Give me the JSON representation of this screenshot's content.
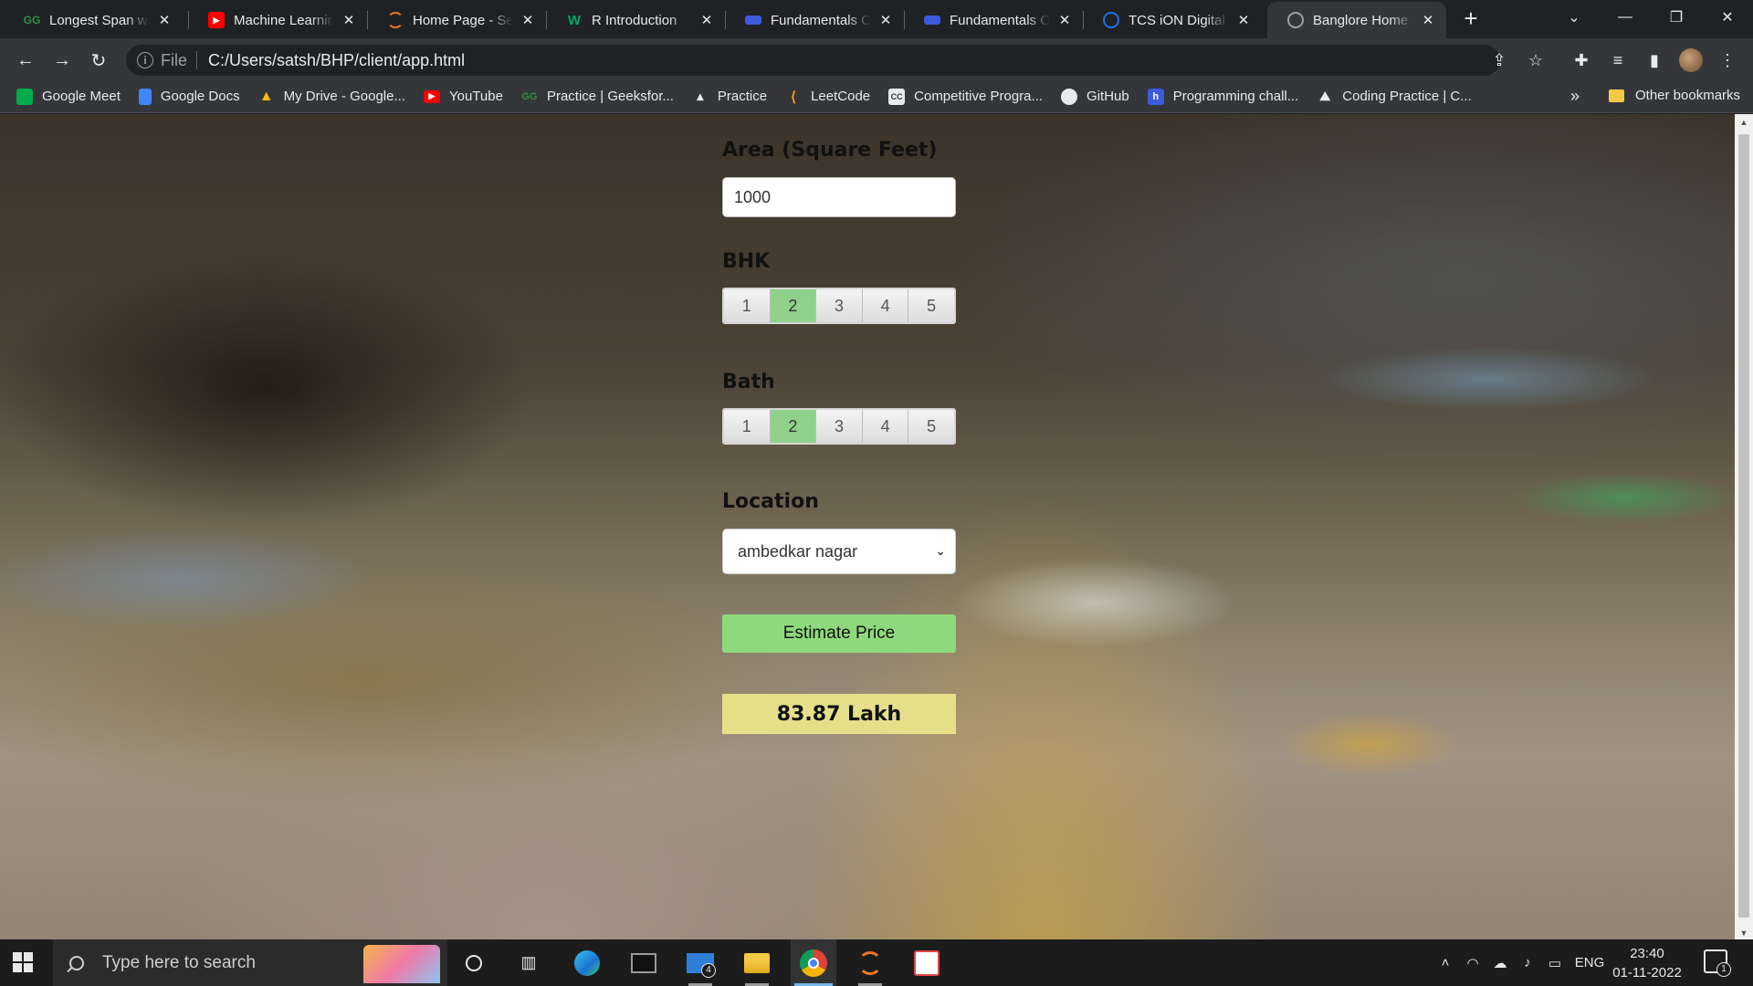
{
  "browser": {
    "tabs": [
      {
        "title": "Longest Span with",
        "favicon": "geeksforgeeks-icon",
        "icon_color": "#2f8d46"
      },
      {
        "title": "Machine Learning",
        "favicon": "youtube-icon",
        "icon_color": "#ff0000"
      },
      {
        "title": "Home Page - Sele",
        "favicon": "jupyter-icon",
        "icon_color": "#f37626"
      },
      {
        "title": "R Introduction",
        "favicon": "w3schools-icon",
        "icon_color": "#04aa6d"
      },
      {
        "title": "Fundamentals Of",
        "favicon": "course-icon",
        "icon_color": "#3b5bdb"
      },
      {
        "title": "Fundamentals Of",
        "favicon": "course-icon",
        "icon_color": "#3b5bdb"
      },
      {
        "title": "TCS iON Digital L",
        "favicon": "power-icon",
        "icon_color": "#1a73e8"
      },
      {
        "title": "Banglore Home P",
        "favicon": "globe-icon",
        "icon_color": "#9aa0a6",
        "active": true
      }
    ],
    "address": {
      "scheme_label": "File",
      "url": "C:/Users/satsh/BHP/client/app.html"
    },
    "bookmarks": [
      {
        "label": "Google Meet",
        "icon": "google-meet-icon",
        "icon_color": "#00ac47"
      },
      {
        "label": "Google Docs",
        "icon": "google-docs-icon",
        "icon_color": "#4285f4"
      },
      {
        "label": "My Drive - Google...",
        "icon": "google-drive-icon",
        "icon_color": "#fbbc04"
      },
      {
        "label": "YouTube",
        "icon": "youtube-icon",
        "icon_color": "#ff0000"
      },
      {
        "label": "Practice | Geeksfor...",
        "icon": "geeksforgeeks-icon",
        "icon_color": "#2f8d46"
      },
      {
        "label": "Practice",
        "icon": "rocket-icon",
        "icon_color": "#e8eaed"
      },
      {
        "label": "LeetCode",
        "icon": "leetcode-icon",
        "icon_color": "#ffa116"
      },
      {
        "label": "Competitive Progra...",
        "icon": "codechef-icon",
        "icon_color": "#e8eaed"
      },
      {
        "label": "GitHub",
        "icon": "github-icon",
        "icon_color": "#e8eaed"
      },
      {
        "label": "Programming chall...",
        "icon": "hackerrank-icon",
        "icon_color": "#3b5bdb"
      },
      {
        "label": "Coding Practice | C...",
        "icon": "codingninjas-icon",
        "icon_color": "#e8eaed"
      }
    ],
    "bookmarks_overflow": "»",
    "other_bookmarks": "Other bookmarks"
  },
  "form": {
    "area_label": "Area (Square Feet)",
    "area_value": "1000",
    "bhk_label": "BHK",
    "bhk_options": [
      "1",
      "2",
      "3",
      "4",
      "5"
    ],
    "bhk_selected": "2",
    "bath_label": "Bath",
    "bath_options": [
      "1",
      "2",
      "3",
      "4",
      "5"
    ],
    "bath_selected": "2",
    "location_label": "Location",
    "location_value": "ambedkar nagar",
    "estimate_button": "Estimate Price",
    "result": "83.87 Lakh",
    "selected_color": "#8fd18a",
    "result_color": "#e6df8a"
  },
  "taskbar": {
    "search_placeholder": "Type here to search",
    "mail_badge": "4",
    "language": "ENG",
    "time": "23:40",
    "date": "01-11-2022",
    "notification_count": "1"
  }
}
